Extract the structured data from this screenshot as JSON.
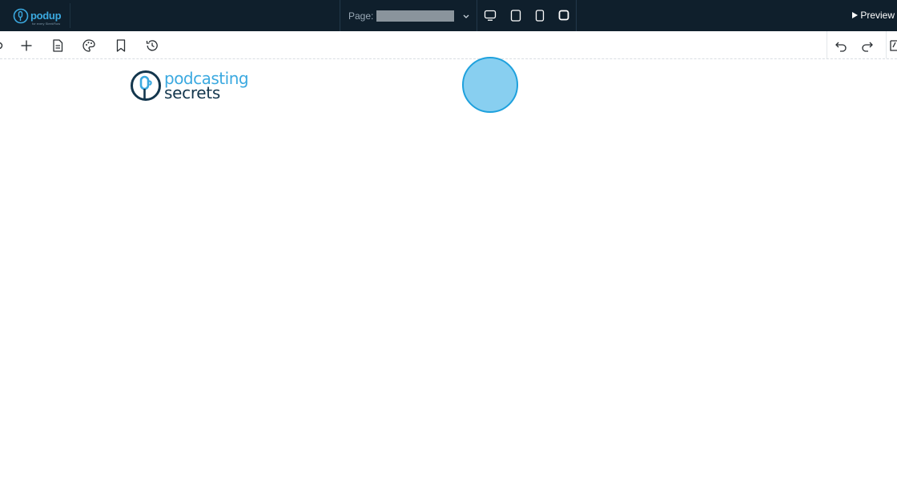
{
  "topbar": {
    "brand": {
      "name": "podup",
      "tagline": "for every SleekFlow"
    },
    "page_selector": {
      "label": "Page:",
      "value": "",
      "caret_icon": "chevron-down-icon"
    },
    "devices": [
      "desktop-icon",
      "tablet-icon",
      "mobile-icon",
      "square-icon"
    ],
    "preview_label": "Preview"
  },
  "toolbar": {
    "left_icons": [
      "plus-icon",
      "document-icon",
      "palette-icon",
      "bookmark-icon",
      "history-icon"
    ],
    "right_icons": [
      "undo-icon",
      "redo-icon",
      "edit-icon"
    ]
  },
  "canvas": {
    "logo": {
      "line1": "podcasting",
      "line2": "secrets"
    }
  },
  "colors": {
    "topbar_bg": "#0f1f2c",
    "accent": "#3ba9e0",
    "logo_dark": "#13364d",
    "cursor_fill": "#88cff0"
  }
}
